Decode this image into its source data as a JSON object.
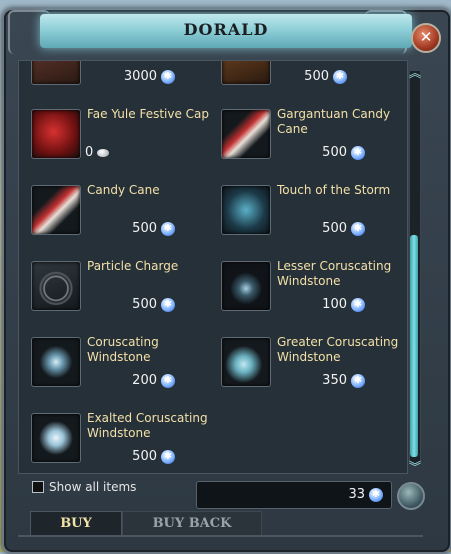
{
  "window": {
    "title": "DORALD"
  },
  "items": [
    {
      "name": "",
      "price": "3000",
      "currency": "astral-diamond-icon"
    },
    {
      "name": "",
      "price": "500",
      "currency": "astral-diamond-icon"
    },
    {
      "name": "Fae Yule Festive Cap",
      "price": "0",
      "currency": "silver-coin-icon"
    },
    {
      "name": "Gargantuan Candy Cane",
      "price": "500",
      "currency": "astral-diamond-icon"
    },
    {
      "name": "Candy Cane",
      "price": "500",
      "currency": "astral-diamond-icon"
    },
    {
      "name": "Touch of the Storm",
      "price": "500",
      "currency": "astral-diamond-icon"
    },
    {
      "name": "Particle Charge",
      "price": "500",
      "currency": "astral-diamond-icon"
    },
    {
      "name": "Lesser Coruscating Windstone",
      "price": "100",
      "currency": "astral-diamond-icon"
    },
    {
      "name": "Coruscating Windstone",
      "price": "200",
      "currency": "astral-diamond-icon"
    },
    {
      "name": "Greater Coruscating Windstone",
      "price": "350",
      "currency": "astral-diamond-icon"
    },
    {
      "name": "Exalted Coruscating Windstone",
      "price": "500",
      "currency": "astral-diamond-icon"
    }
  ],
  "footer": {
    "show_all_label": "Show all items",
    "balance": "33"
  },
  "tabs": {
    "buy": "BUY",
    "buy_back": "BUY BACK"
  },
  "icons": {
    "close": "close-icon",
    "currency": "astral-diamond-icon"
  }
}
